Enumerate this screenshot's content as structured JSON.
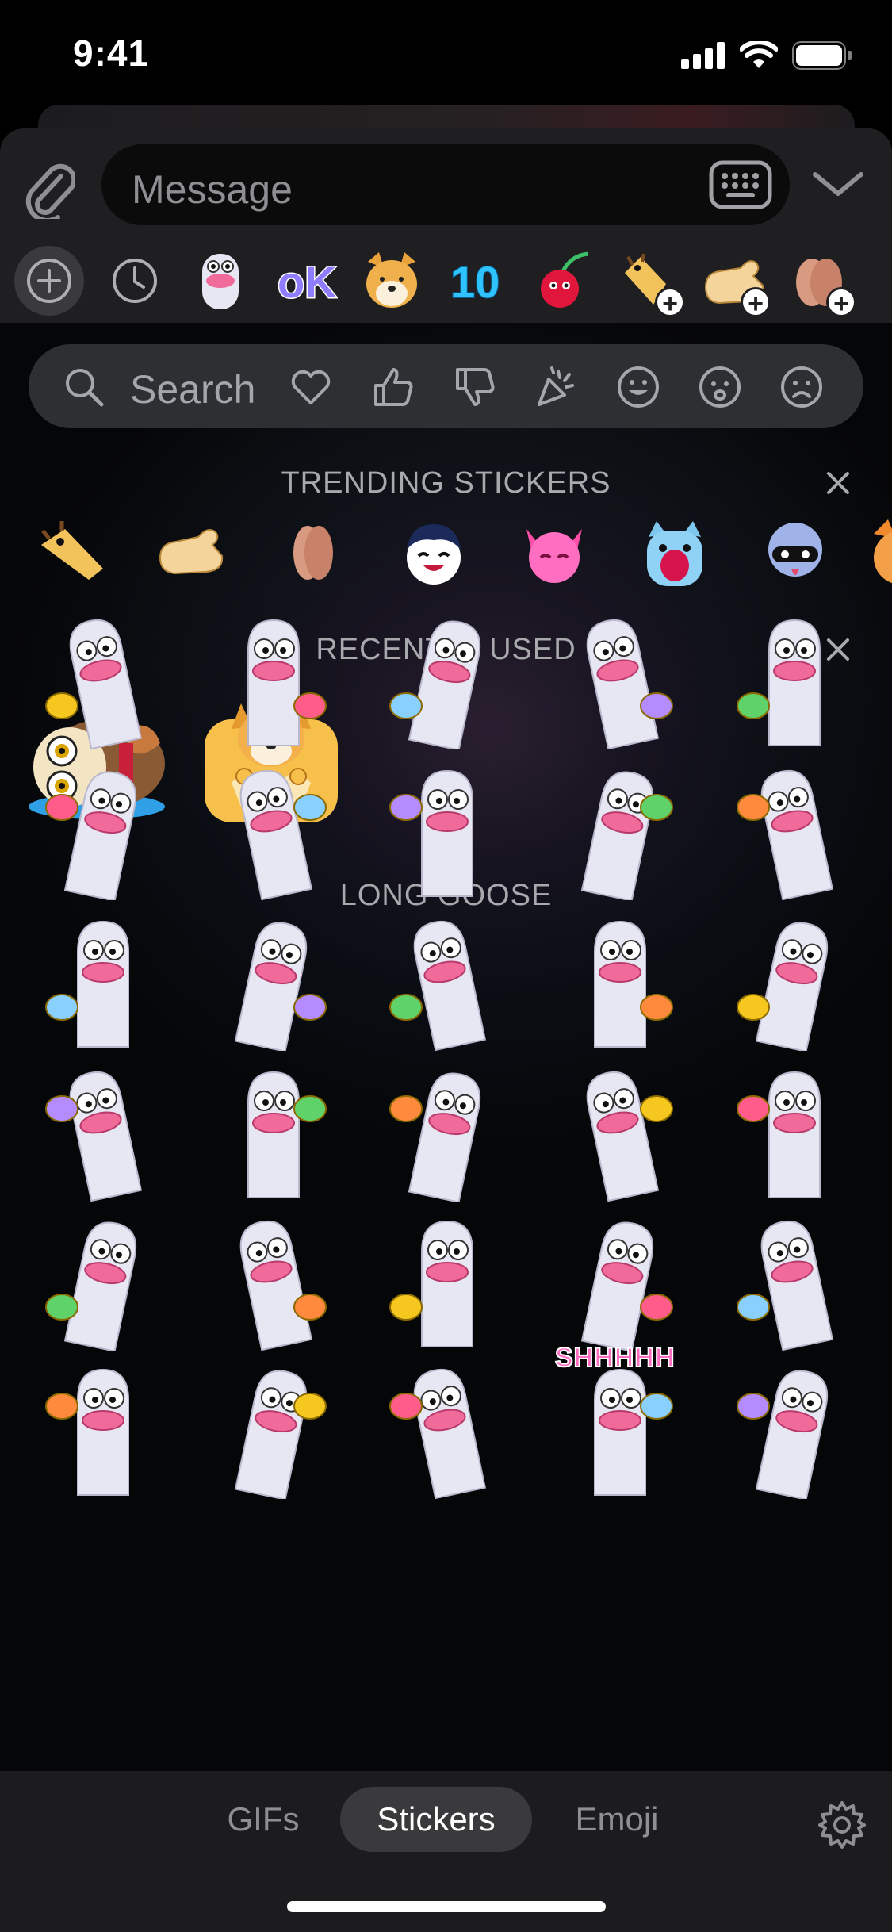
{
  "status_bar": {
    "time": "9:41",
    "icons": [
      "signal-icon",
      "wifi-icon",
      "battery-icon"
    ]
  },
  "input": {
    "placeholder": "Message",
    "icons": [
      "paperclip-icon",
      "keyboard-icon",
      "chevron-down-icon"
    ]
  },
  "pack_row": {
    "items": [
      "add-pack",
      "recent",
      "long-goose",
      "ok-pack",
      "doge-pack",
      "ten-pack",
      "cherry-pack",
      "fox-pack",
      "hand-pack",
      "peach-pack"
    ],
    "active": "add-pack"
  },
  "search": {
    "placeholder": "Search",
    "categories": [
      "heart-icon",
      "thumbs-up-icon",
      "thumbs-down-icon",
      "party-popper-icon",
      "smile-icon",
      "sad-icon",
      "frown-icon"
    ]
  },
  "sections": {
    "trending": {
      "title": "TRENDING STICKERS",
      "close": "×"
    },
    "recent": {
      "title": "RECENTLY USED",
      "close": "×"
    },
    "pack": {
      "title": "LONG GOOSE"
    }
  },
  "trending_items": [
    "fox-sticker",
    "hand-sticker",
    "peach-sticker",
    "panda-girl-sticker",
    "pink-cat-sticker",
    "white-cat-sticker",
    "masked-girl-sticker",
    "orange-fox-sticker"
  ],
  "recent_items": [
    "owl-sticker",
    "doge-sticker"
  ],
  "goose_stickers": {
    "overlay_text": "SHHHHH",
    "count": 30
  },
  "tabs": {
    "gifs": "GIFs",
    "stickers": "Stickers",
    "emoji": "Emoji",
    "active": "stickers"
  },
  "colors": {
    "panel": "#1f1f21",
    "search": "#2c3033",
    "goose_body": "#e7e6f3",
    "beak": "#f06a9a",
    "accent_yellow": "#f6c81f"
  }
}
